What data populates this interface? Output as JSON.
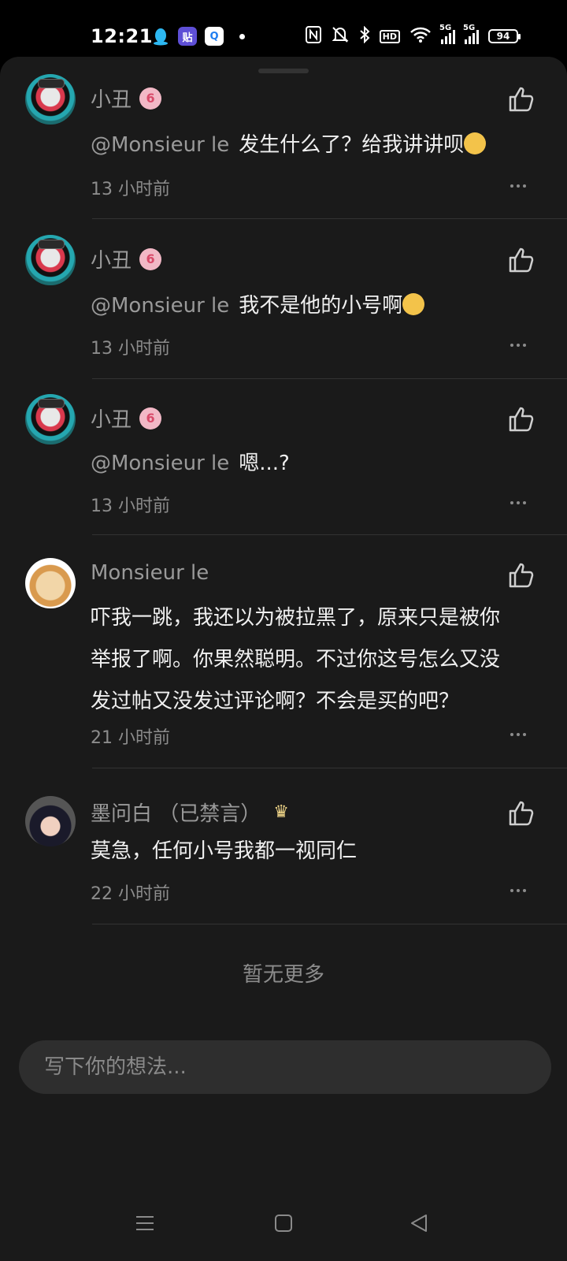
{
  "status_bar": {
    "time": "12:21",
    "network_1": "5G",
    "network_2": "5G",
    "hd": "HD",
    "battery": "94",
    "app_icons": [
      "qq-icon",
      "tieba-icon",
      "q-browser-icon"
    ]
  },
  "comments": [
    {
      "user": "小丑",
      "badge": "6",
      "mention": "@Monsieur le",
      "text": "发生什么了？给我讲讲呗",
      "emoji": "thinking-face-emoji",
      "time": "13 小时前"
    },
    {
      "user": "小丑",
      "badge": "6",
      "mention": "@Monsieur le",
      "text": "我不是他的小号啊",
      "emoji": "grinning-sweat-emoji",
      "time": "13 小时前"
    },
    {
      "user": "小丑",
      "badge": "6",
      "mention": "@Monsieur le",
      "text": "嗯...?",
      "time": "13 小时前"
    },
    {
      "user": "Monsieur le",
      "text_lines": [
        "吓我一跳，我还以为被拉黑了，原来只是被你",
        "举报了啊。你果然聪明。不过你这号怎么又没",
        "发过帖又没发过评论啊？不会是买的吧？"
      ],
      "time": "21 小时前"
    },
    {
      "user": "墨问白 （已禁言）",
      "text": "莫急，任何小号我都一视同仁",
      "time": "22 小时前"
    }
  ],
  "footer": {
    "no_more": "暂无更多",
    "input_placeholder": "写下你的想法..."
  },
  "navigation": [
    "menu-icon",
    "home-square-icon",
    "back-triangle-icon"
  ],
  "colors": {
    "sheet_bg": "#1a1a1a",
    "username": "#9a9a9a",
    "body_text": "#f0f0f0",
    "badge_bg": "#f2b8c6"
  }
}
